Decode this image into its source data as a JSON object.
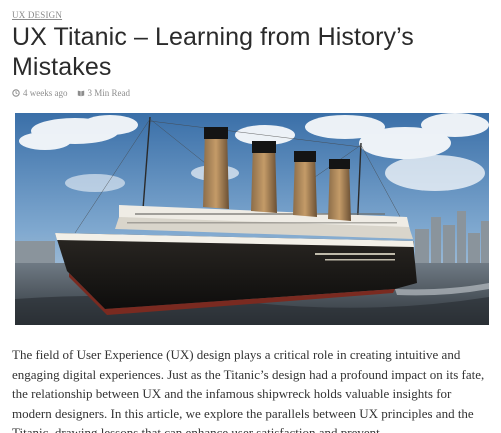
{
  "article": {
    "category": "UX DESIGN",
    "title": "UX Titanic – Learning from History’s Mistakes",
    "meta": {
      "posted": "4 weeks ago",
      "read_time": "3 Min Read"
    },
    "hero_alt": "Titanic ship sailing",
    "intro": "The field of User Experience (UX) design plays a critical role in creating intuitive and engaging digital experiences. Just as the Titanic’s design had a profound impact on its fate, the relationship between UX and the infamous shipwreck holds valuable insights for modern designers. In this article, we explore the parallels between UX principles and the Titanic, drawing lessons that can enhance user satisfaction and prevent"
  },
  "icons": {
    "clock": "clock-icon",
    "book": "book-icon"
  },
  "colors": {
    "title": "#2b2b2b",
    "meta": "#8d8d8d",
    "body_text": "#333333"
  }
}
